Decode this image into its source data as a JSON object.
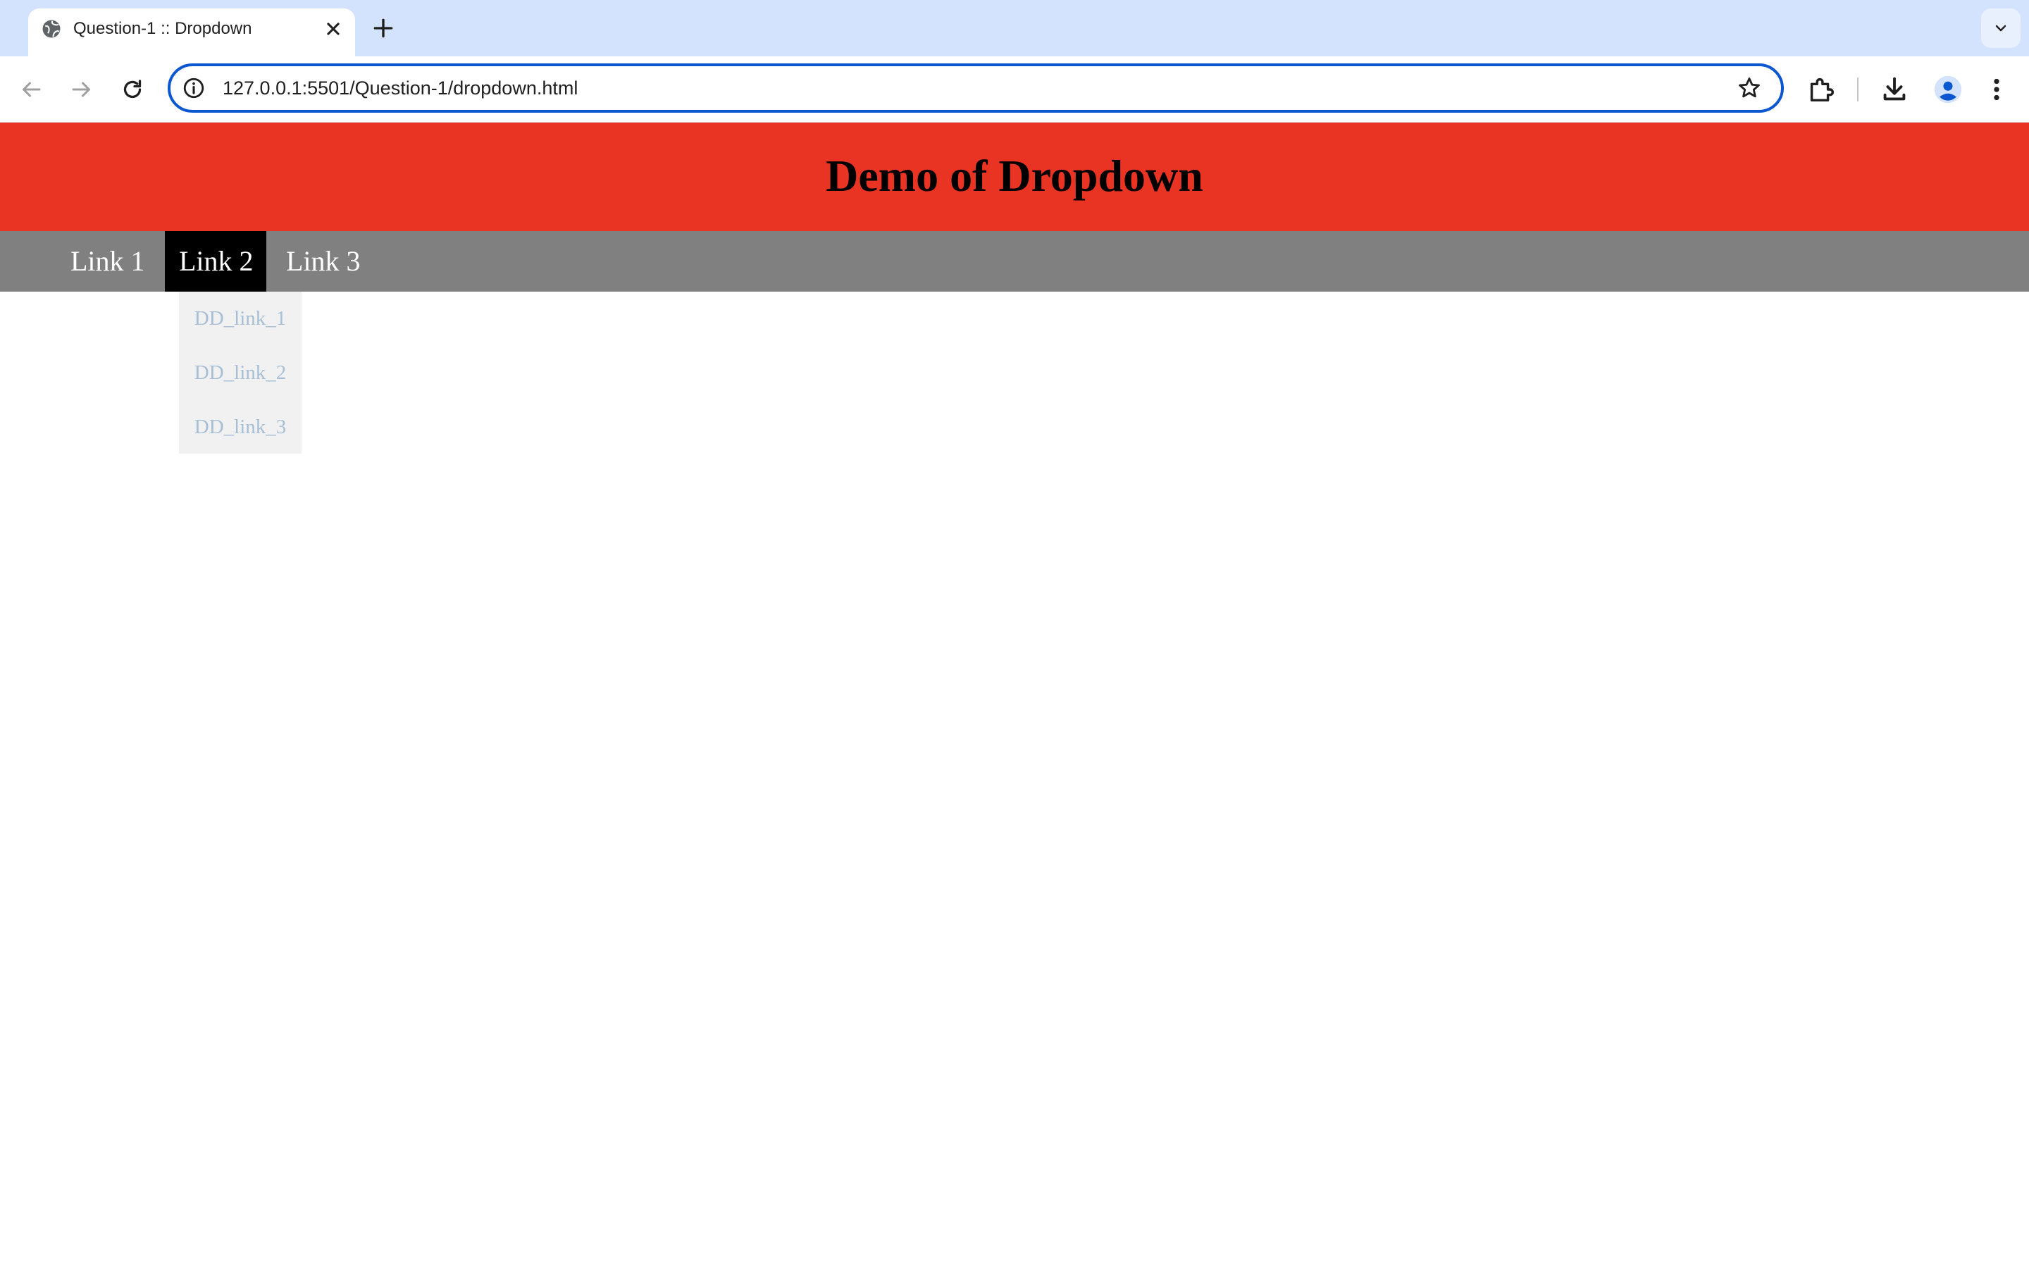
{
  "browser": {
    "tab": {
      "title": "Question-1 :: Dropdown",
      "favicon": "globe-icon"
    },
    "url": "127.0.0.1:5501/Question-1/dropdown.html",
    "accent_color": "#0b57d0",
    "tabstrip_color": "#d3e3fd"
  },
  "page": {
    "header": {
      "title": "Demo of Dropdown",
      "background": "#e93323"
    },
    "navbar": {
      "background": "#808080",
      "links": [
        {
          "label": "Link 1",
          "active": false
        },
        {
          "label": "Link 2",
          "active": true
        },
        {
          "label": "Link 3",
          "active": false
        }
      ]
    },
    "dropdown": {
      "background": "#f1f1f1",
      "item_color": "#a6bfd6",
      "items": [
        {
          "label": "DD_link_1"
        },
        {
          "label": "DD_link_2"
        },
        {
          "label": "DD_link_3"
        }
      ]
    }
  }
}
